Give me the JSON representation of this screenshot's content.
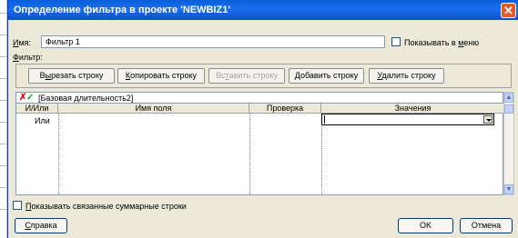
{
  "dialog": {
    "title": "Определение фильтра в проекте 'NEWBIZ1'",
    "close_symbol": "✕"
  },
  "name_label": {
    "prefix": "",
    "mnemonic": "И",
    "suffix": "мя:"
  },
  "name_value": "Фильтр 1",
  "show_in_menu": {
    "prefix": "Показывать в ",
    "mnemonic": "м",
    "suffix": "еню",
    "checked": false
  },
  "filter_label": {
    "prefix": "",
    "mnemonic": "Ф",
    "suffix": "ильтр:"
  },
  "toolbar": {
    "cut": {
      "prefix": "В",
      "mnemonic": "ы",
      "suffix": "резать строку"
    },
    "copy": {
      "prefix": "",
      "mnemonic": "К",
      "suffix": "опировать строку"
    },
    "paste": {
      "prefix": "Вс",
      "mnemonic": "т",
      "suffix": "авить строку",
      "disabled": true
    },
    "add": {
      "prefix": "",
      "mnemonic": "Д",
      "suffix": "обавить строку"
    },
    "delete": {
      "prefix": "",
      "mnemonic": "У",
      "suffix": "далить строку"
    }
  },
  "entry_bar": {
    "text": "[Базовая длительность2]"
  },
  "grid": {
    "columns": [
      "И/Или",
      "Имя поля",
      "Проверка",
      "Значения"
    ],
    "rows": [
      {
        "and_or": "Или",
        "field": "",
        "test": "",
        "value": ""
      }
    ]
  },
  "show_summary": {
    "prefix": "",
    "mnemonic": "П",
    "suffix": "оказывать связанные суммарные строки",
    "checked": false
  },
  "help_button": {
    "prefix": "",
    "mnemonic": "С",
    "suffix": "правка"
  },
  "ok_button": "OK",
  "cancel_button": "Отмена"
}
